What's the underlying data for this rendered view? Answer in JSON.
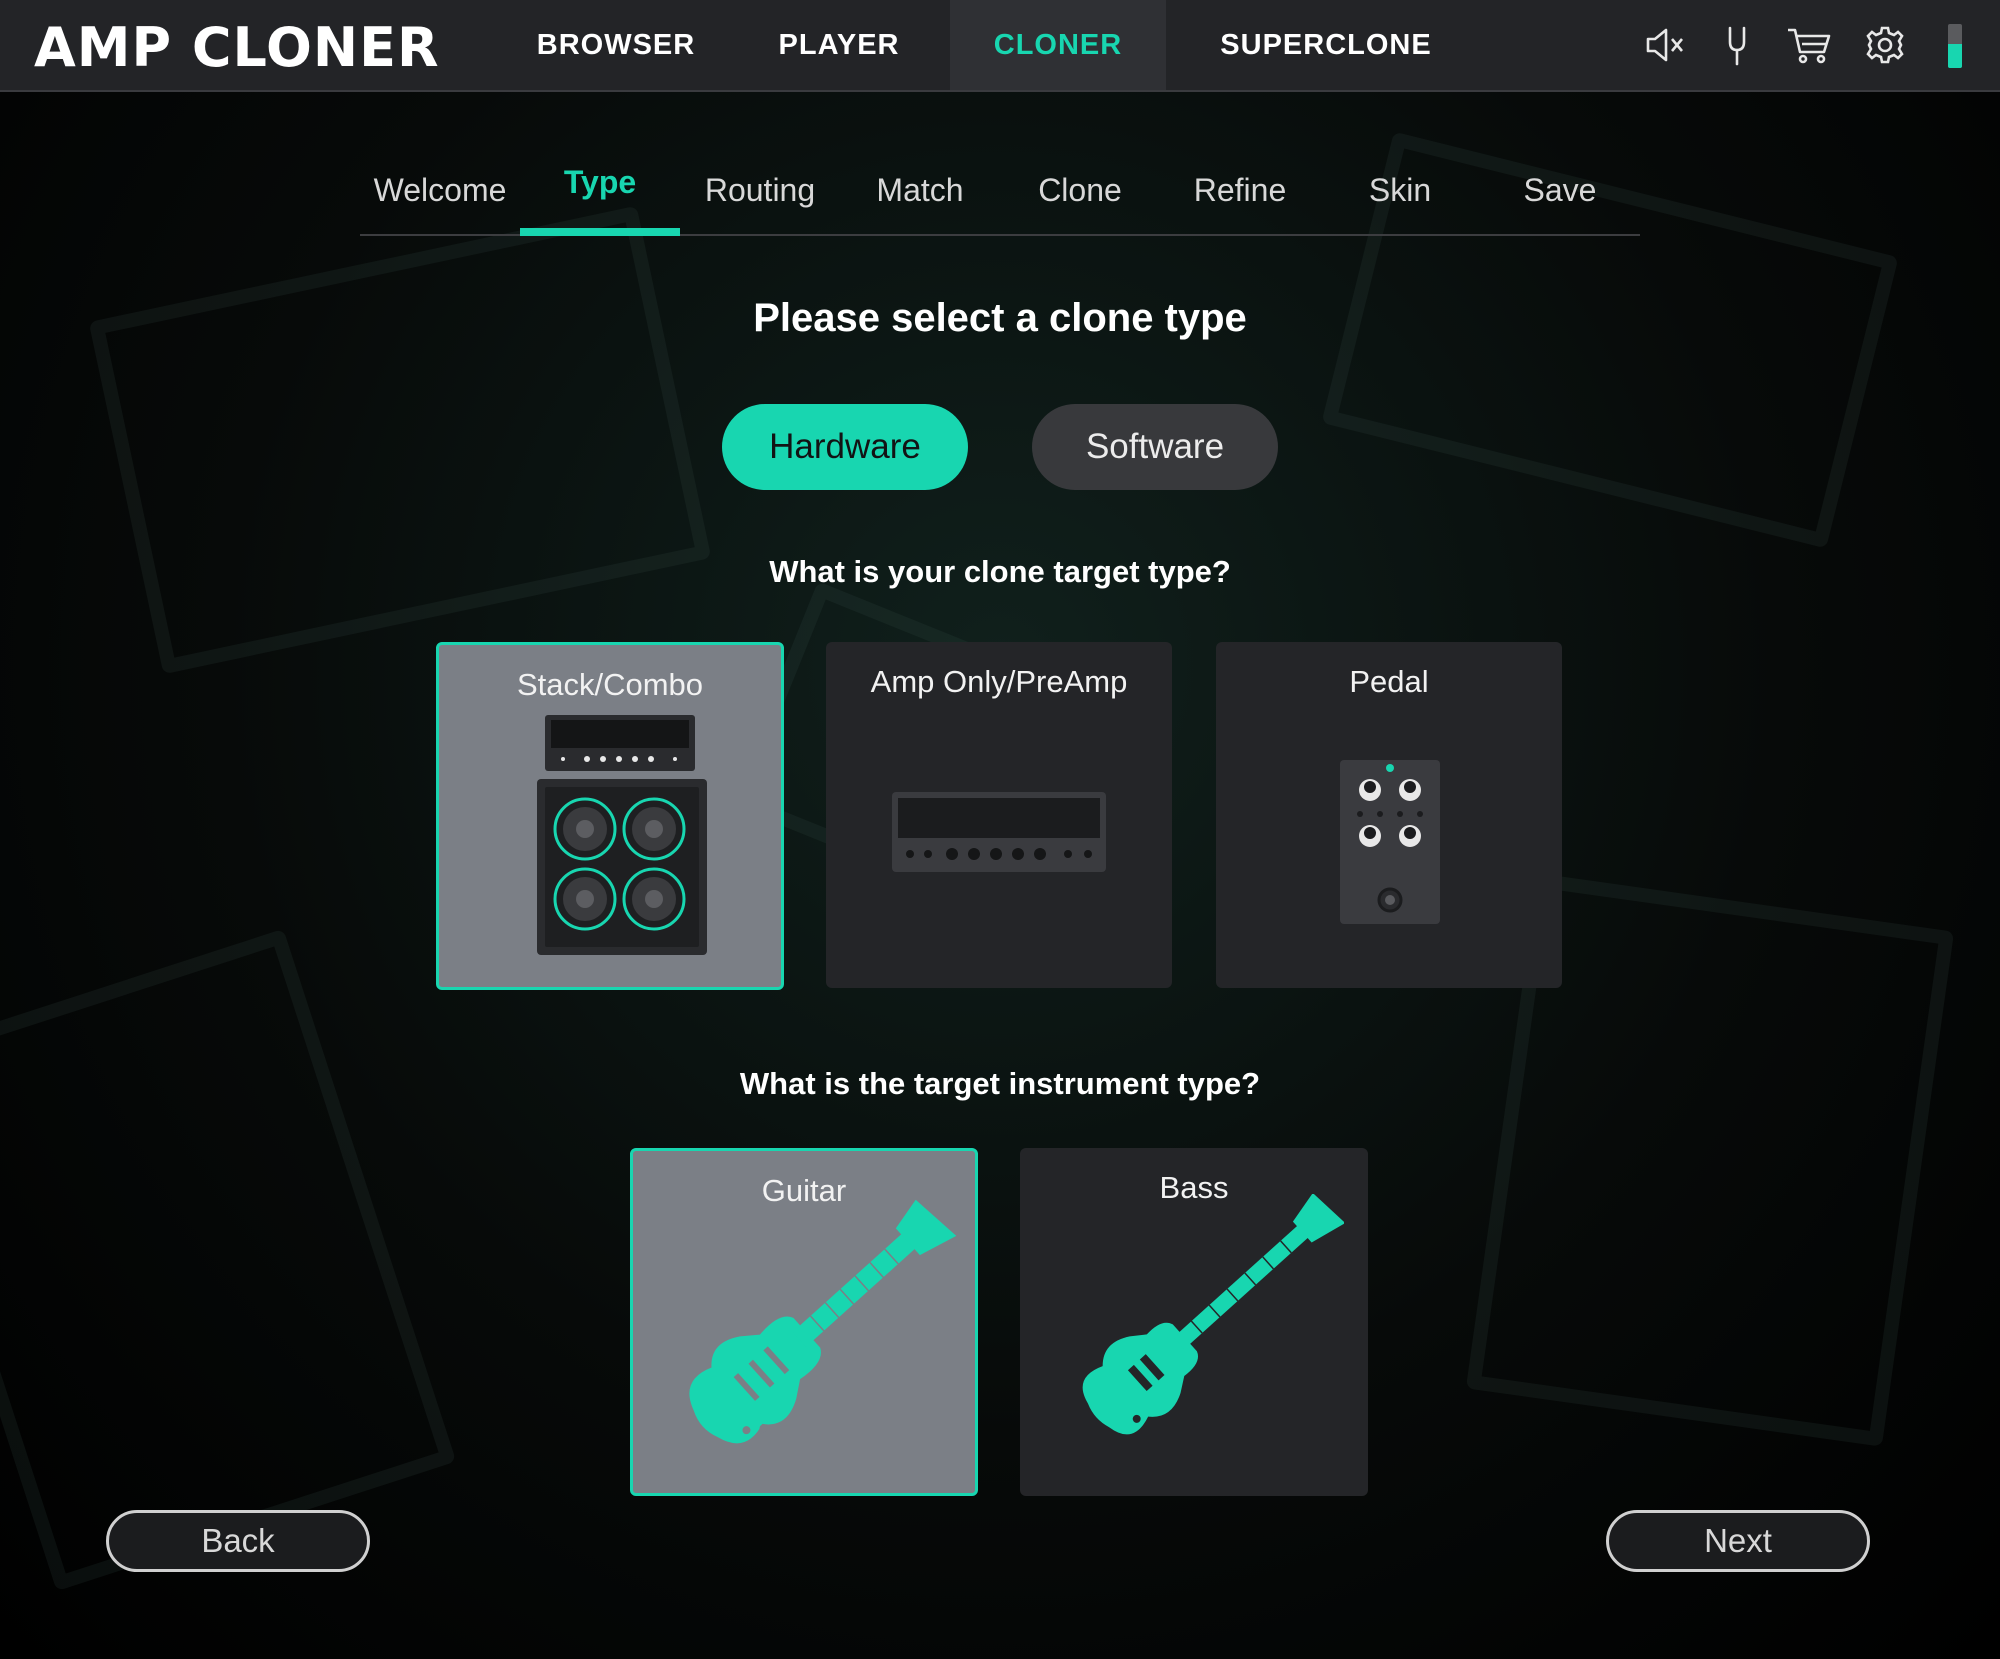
{
  "app": {
    "logo": "AMP CLONER"
  },
  "nav": {
    "tabs": [
      {
        "label": "BROWSER"
      },
      {
        "label": "PLAYER"
      },
      {
        "label": "CLONER"
      },
      {
        "label": "SUPERCLONE"
      }
    ],
    "active": "CLONER",
    "icons": [
      "speaker-muted-icon",
      "tuning-fork-icon",
      "cart-icon",
      "gear-icon"
    ],
    "level_meter_fill": 0.55
  },
  "steps": {
    "items": [
      "Welcome",
      "Type",
      "Routing",
      "Match",
      "Clone",
      "Refine",
      "Skin",
      "Save"
    ],
    "active": "Type"
  },
  "main": {
    "title": "Please select a clone type",
    "clone_type": {
      "options": [
        "Hardware",
        "Software"
      ],
      "selected": "Hardware"
    },
    "target_question": "What is your clone target type?",
    "targets": [
      {
        "label": "Stack/Combo",
        "selected": true,
        "icon": "amp-stack-icon"
      },
      {
        "label": "Amp Only/PreAmp",
        "selected": false,
        "icon": "amp-head-icon"
      },
      {
        "label": "Pedal",
        "selected": false,
        "icon": "pedal-icon"
      }
    ],
    "instrument_question": "What is the target instrument type?",
    "instruments": [
      {
        "label": "Guitar",
        "selected": true,
        "icon": "electric-guitar-icon"
      },
      {
        "label": "Bass",
        "selected": false,
        "icon": "bass-guitar-icon"
      }
    ]
  },
  "footer": {
    "back_label": "Back",
    "next_label": "Next"
  },
  "colors": {
    "accent": "#18d6b0",
    "topbar": "#232427",
    "card": "#242528",
    "card_selected": "#7b7f86"
  }
}
